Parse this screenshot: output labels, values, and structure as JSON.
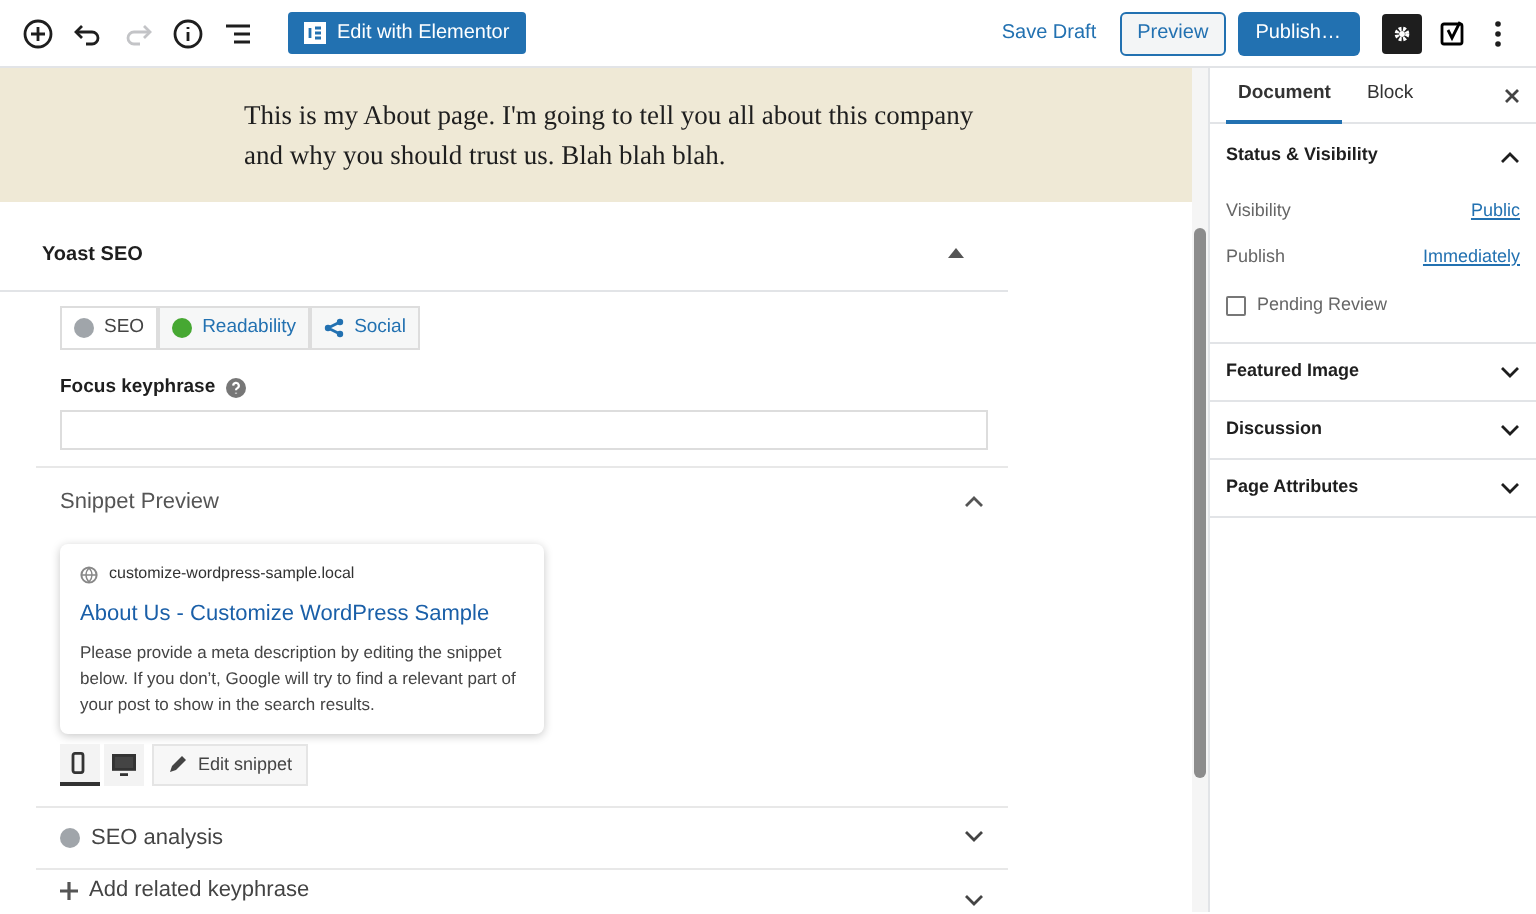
{
  "toolbar": {
    "tools": [
      {
        "kind": "add",
        "disabled": false
      },
      {
        "kind": "undo",
        "disabled": false
      },
      {
        "kind": "redo",
        "disabled": true
      },
      {
        "kind": "info",
        "disabled": false
      },
      {
        "kind": "outline",
        "disabled": false
      }
    ],
    "elementor_button": "Edit with Elementor",
    "save_draft": "Save Draft",
    "preview": "Preview",
    "publish": "Publish…",
    "settings_selected": true
  },
  "content": {
    "text": "This is my About page. I'm going to tell you all about this company and why you should trust us. Blah blah blah."
  },
  "yoast": {
    "title": "Yoast SEO",
    "expanded": true,
    "tabs": [
      {
        "label": "SEO",
        "selected": true,
        "kind": "score",
        "color": "#a0a5aa"
      },
      {
        "label": "Readability",
        "selected": false,
        "kind": "score",
        "color": "#46a832"
      },
      {
        "label": "Social",
        "selected": false,
        "kind": "share"
      }
    ],
    "focus_keyphrase": {
      "label": "Focus keyphrase"
    },
    "snippet": {
      "title": "Snippet Preview",
      "expanded": true,
      "url": "customize-wordpress-sample.local",
      "link_title": "About Us - Customize WordPress Sample",
      "description": "Please provide a meta description by editing the snippet below. If you don’t, Google will try to find a relevant part of your post to show in the search results.",
      "devices": [
        {
          "kind": "mobile",
          "selected": true
        },
        {
          "kind": "desktop",
          "selected": false
        }
      ],
      "edit_button": "Edit snippet"
    },
    "sections": [
      {
        "kind": "analysis",
        "label": "SEO analysis",
        "color": "#a0a5aa",
        "expanded": false
      },
      {
        "kind": "add",
        "label": "Add related keyphrase",
        "expanded": false
      }
    ]
  },
  "sidebar": {
    "tabs": [
      {
        "label": "Document",
        "selected": true
      },
      {
        "label": "Block",
        "selected": false
      }
    ],
    "panels": [
      {
        "title": "Status & Visibility",
        "expanded": true,
        "rows": [
          {
            "kind": "link",
            "label": "Visibility",
            "value": "Public"
          },
          {
            "kind": "link",
            "label": "Publish",
            "value": "Immediately"
          },
          {
            "kind": "checkbox",
            "label": "Pending Review",
            "checked": false
          }
        ]
      },
      {
        "title": "Featured Image",
        "expanded": false
      },
      {
        "title": "Discussion",
        "expanded": false
      },
      {
        "title": "Page Attributes",
        "expanded": false
      }
    ]
  }
}
